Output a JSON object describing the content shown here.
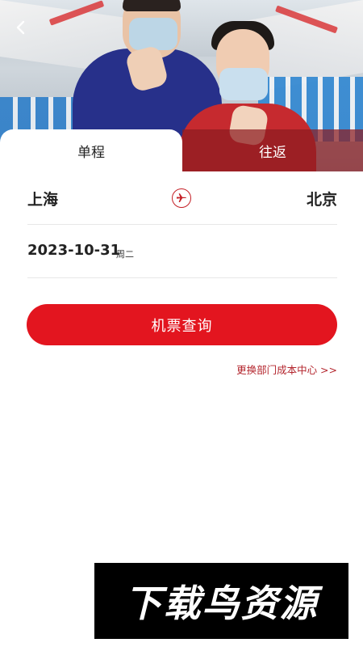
{
  "header": {
    "back_icon": "chevron-left-icon"
  },
  "tabs": [
    {
      "label": "单程",
      "active": true
    },
    {
      "label": "往返",
      "active": false
    }
  ],
  "route": {
    "from": "上海",
    "to": "北京",
    "swap_icon": "plane-icon"
  },
  "date": {
    "value": "2023-10-31",
    "weekday": "周二"
  },
  "search_button": {
    "label": "机票查询"
  },
  "dept_link": {
    "label": "更换部门成本中心 >>"
  },
  "watermark": {
    "text": "下载鸟资源"
  },
  "colors": {
    "accent": "#e3151f",
    "link": "#b3242c",
    "tab_inactive": "#8c1c20"
  }
}
